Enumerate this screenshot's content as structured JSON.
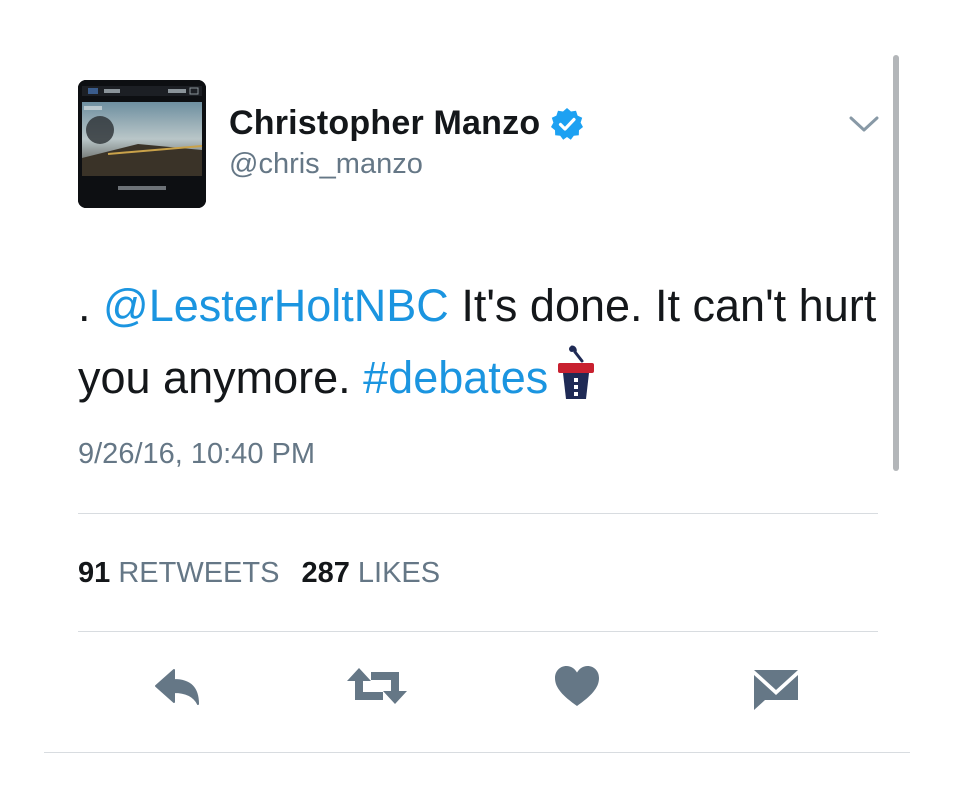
{
  "tweet": {
    "author_name": "Christopher Manzo",
    "author_handle": "@chris_manzo",
    "text_prefix": ". ",
    "mention": "@LesterHoltNBC",
    "text_middle": " It's done. It can't hurt you anymore. ",
    "hashtag": "#debates",
    "timestamp": "9/26/16, 10:40 PM"
  },
  "stats": {
    "retweets_count": "91",
    "retweets_label": "RETWEETS",
    "likes_count": "287",
    "likes_label": "LIKES"
  },
  "icons": {
    "verified": "verified-badge-icon",
    "more": "chevron-down-icon",
    "hashtag_emoji": "podium-icon",
    "reply": "reply-icon",
    "retweet": "retweet-icon",
    "like": "heart-icon",
    "message": "envelope-icon"
  },
  "colors": {
    "link": "#1b95e0",
    "text": "#14171a",
    "muted": "#657786",
    "action_icon": "#657786",
    "verified": "#1da1f2"
  }
}
